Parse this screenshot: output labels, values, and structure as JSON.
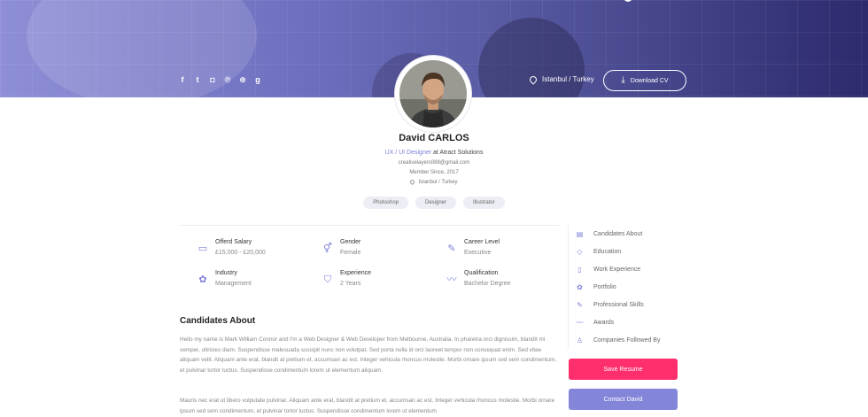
{
  "colors": {
    "accent": "#7d7fd8",
    "save_button": "#ff2e6d",
    "contact_button": "#8385d9",
    "hero_start": "#8e8fd6",
    "hero_end": "#2d2a6e"
  },
  "header": {
    "socials": [
      {
        "icon": "facebook-icon",
        "glyph": "f"
      },
      {
        "icon": "twitter-icon",
        "glyph": "t"
      },
      {
        "icon": "instagram-icon",
        "glyph": "◘"
      },
      {
        "icon": "pinterest-icon",
        "glyph": "℗"
      },
      {
        "icon": "dribbble-icon",
        "glyph": "⊛"
      },
      {
        "icon": "google-plus-icon",
        "glyph": "g"
      }
    ],
    "location": "Istanbul / Turkey",
    "download_label": "Download CV"
  },
  "profile": {
    "name": "David CARLOS",
    "role": "UX / UI Designer",
    "company_prefix": " at Atract Solutions",
    "email": "creativelayers088@gmail.com",
    "member_since": "Member Since, 2017",
    "location": "Istanbul / Turkey",
    "skills": [
      "Photoshop",
      "Designer",
      "Illustrator"
    ]
  },
  "info": [
    {
      "label": "Offerd Salary",
      "value": "£15,000 - £20,000",
      "icon": "money-icon"
    },
    {
      "label": "Gender",
      "value": "Female",
      "icon": "gender-icon"
    },
    {
      "label": "Career Level",
      "value": "Executive",
      "icon": "pin-icon"
    },
    {
      "label": "Industry",
      "value": "Management",
      "icon": "puzzle-icon"
    },
    {
      "label": "Experience",
      "value": "2 Years",
      "icon": "shield-icon"
    },
    {
      "label": "Qualification",
      "value": "Bachelor Degree",
      "icon": "chart-icon"
    }
  ],
  "about": {
    "title": "Candidates About",
    "p1": "Hello my name is Mark William Connor and I'm a Web Designer & Web Developer from Melbourne, Australia. In pharetra orci dignissim, blandit mi semper, ultricies diam. Suspendisse malesuada suscipit nunc non volutpat. Sed porta nulla id orci laoreet tempor non consequat enim. Sed vitae aliquam velit. Aliquam ante erat, blandit at pretium et, accumsan ac est. Integer vehicula rhoncus molestie. Morbi ornare ipsum sed sem condimentum, et pulvinar tortor luctus. Suspendisse condimentum lorem ut elementum aliquam.",
    "p2": "Mauris nec erat ut libero vulputate pulvinar. Aliquam ante erat, blandit at pretium et, accumsan ac est. Integer vehicula rhoncus molestie. Morbi ornare ipsum sed sem condimentum, et pulvinar tortor luctus. Suspendisse condimentum lorem ut elementum"
  },
  "sidebar": {
    "items": [
      {
        "label": "Candidates About",
        "icon": "briefcase-icon"
      },
      {
        "label": "Education",
        "icon": "graduation-cap-icon"
      },
      {
        "label": "Work Experience",
        "icon": "document-icon"
      },
      {
        "label": "Portfolio",
        "icon": "puzzle-icon"
      },
      {
        "label": "Professional Skills",
        "icon": "pin-icon"
      },
      {
        "label": "Awards",
        "icon": "chart-icon"
      },
      {
        "label": "Companies Followed By",
        "icon": "user-icon"
      }
    ],
    "save_label": "Save Resume",
    "contact_label": "Contact David"
  }
}
